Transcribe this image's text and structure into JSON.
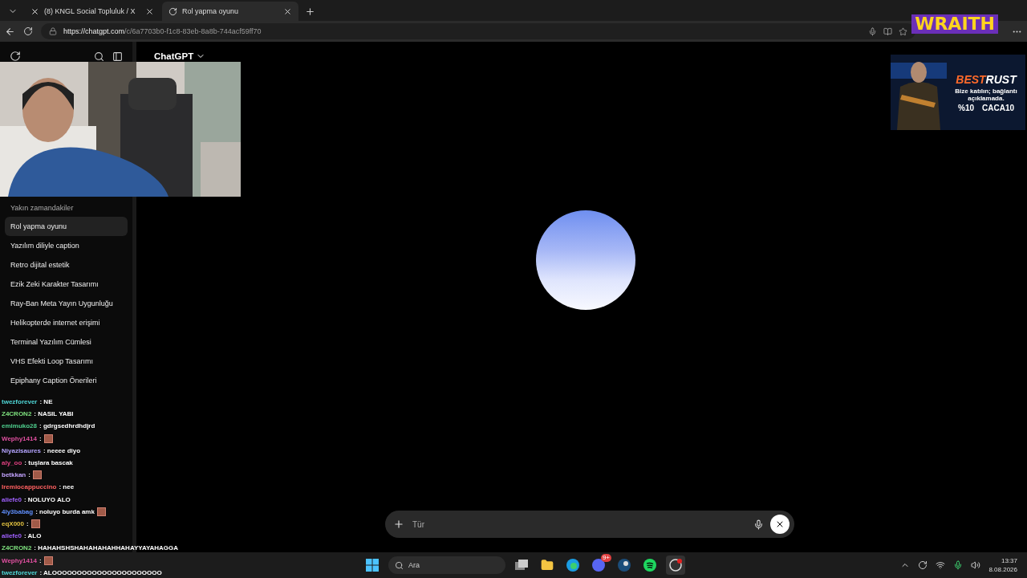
{
  "browser": {
    "tabs": [
      {
        "title": "(8) KNGL Social Topluluk / X",
        "selected": false
      },
      {
        "title": "Rol yapma oyunu",
        "selected": true
      }
    ],
    "url_host": "https://chatgpt.com",
    "url_path": "/c/6a7703b0-f1c8-83eb-8a8b-744acf59ff70"
  },
  "header": {
    "title": "ChatGPT"
  },
  "sidebar": {
    "section": "Yakın zamandakiler",
    "items": [
      {
        "label": "Rol yapma oyunu",
        "selected": true
      },
      {
        "label": "Yazılım diliyle caption",
        "selected": false
      },
      {
        "label": "Retro dijital estetik",
        "selected": false
      },
      {
        "label": "Ezik Zeki Karakter Tasarımı",
        "selected": false
      },
      {
        "label": "Ray-Ban Meta Yayın Uygunluğu",
        "selected": false
      },
      {
        "label": "Helikopterde internet erişimi",
        "selected": false
      },
      {
        "label": "Terminal Yazılım Cümlesi",
        "selected": false
      },
      {
        "label": "VHS Efekti Loop Tasarımı",
        "selected": false
      },
      {
        "label": "Epiphany Caption Önerileri",
        "selected": false
      }
    ]
  },
  "composer": {
    "placeholder": "Tür"
  },
  "overlay": {
    "brand": "WRAITH",
    "ad": {
      "title_a": "BEST",
      "title_b": "RUST",
      "text": "Bize katılın; bağlantı açıklamada.",
      "discount": "%10",
      "code": "CACA10"
    },
    "chat": [
      {
        "user": "twezforever",
        "color": "#4fd6d6",
        "text": ": NE"
      },
      {
        "user": "Z4CRON2",
        "color": "#7ee07e",
        "text": ": NASIL YABI"
      },
      {
        "user": "emimuko28",
        "color": "#4fd08f",
        "text": ": gdrgsedhrdhdjrd"
      },
      {
        "user": "Wephy1414",
        "color": "#e050a0",
        "text": ":",
        "emote": true
      },
      {
        "user": "Niyazisaures",
        "color": "#b4a4ff",
        "text": ": neeee diyo"
      },
      {
        "user": "aly_oo",
        "color": "#e04080",
        "text": ": tuşlara bascak"
      },
      {
        "user": "betkkan",
        "color": "#c4a4ff",
        "text": ":",
        "emote": true
      },
      {
        "user": "Iremiocappuccino",
        "color": "#ff6060",
        "text": ": nee"
      },
      {
        "user": "aliefe0",
        "color": "#a060ff",
        "text": ": NOLUYO ALO"
      },
      {
        "user": "4ly3babag",
        "color": "#6090ff",
        "text": ": noluyo burda amk",
        "emote": true
      },
      {
        "user": "eqX000",
        "color": "#e0c040",
        "text": ":",
        "emote": true
      },
      {
        "user": "aliefe0",
        "color": "#a060ff",
        "text": ": ALO"
      },
      {
        "user": "Z4CRON2",
        "color": "#7ee07e",
        "text": ": HAHAHSHSHAHAHAHAHHAHAYYAYAHAGGA"
      },
      {
        "user": "Wephy1414",
        "color": "#e050a0",
        "text": ":",
        "emote": true
      },
      {
        "user": "twezforever",
        "color": "#4fd6d6",
        "text": ": ALOOOOOOOOOOOOOOOOOOOOOO"
      }
    ]
  },
  "taskbar": {
    "search": "Ara",
    "badge": "9+",
    "time": "13:37",
    "date": "8.08.2026"
  }
}
